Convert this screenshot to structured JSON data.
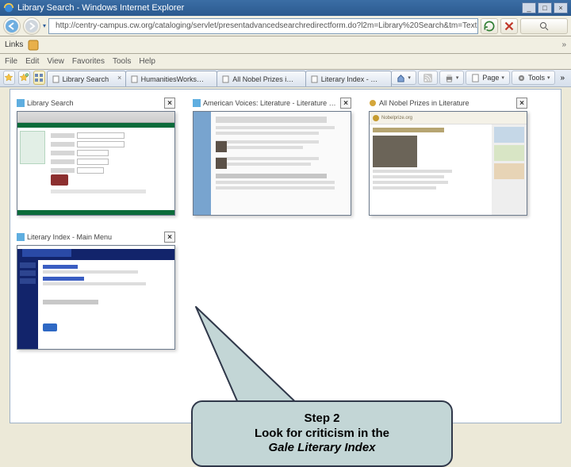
{
  "window": {
    "title": "Library Search - Windows Internet Explorer",
    "min_label": "_",
    "max_label": "□",
    "close_label": "×"
  },
  "address": {
    "url": "http://centry-campus.cw.org/cataloging/servlet/presentadvancedsearchredirectform.do?l2m=Library%20Search&tm=TextualCatalog"
  },
  "links_bar": {
    "label": "Links",
    "chevron": "»"
  },
  "menu": {
    "file": "File",
    "edit": "Edit",
    "view": "View",
    "favorites": "Favorites",
    "tools": "Tools",
    "help": "Help"
  },
  "toolbar": {
    "home": "Home",
    "print": "Print",
    "page": "Page",
    "tools": "Tools"
  },
  "tabs": [
    {
      "label": "Library Search",
      "icon": "page"
    },
    {
      "label": "HumanitiesWorkstation - LC...",
      "icon": "page"
    },
    {
      "label": "All Nobel Prizes in Literature",
      "icon": "page"
    },
    {
      "label": "Literary Index - Main Men...",
      "icon": "page"
    }
  ],
  "thumbnails": [
    {
      "title": "Library Search"
    },
    {
      "title": "American Voices: Literature - Literature Resources"
    },
    {
      "title": "All Nobel Prizes in Literature"
    },
    {
      "title": "Literary Index - Main Menu"
    }
  ],
  "nobel_logo_text": "Nobelprize.org",
  "callout": {
    "line1": "Step 2",
    "line2": "Look for criticism in the",
    "line3": "Gale Literary Index"
  }
}
